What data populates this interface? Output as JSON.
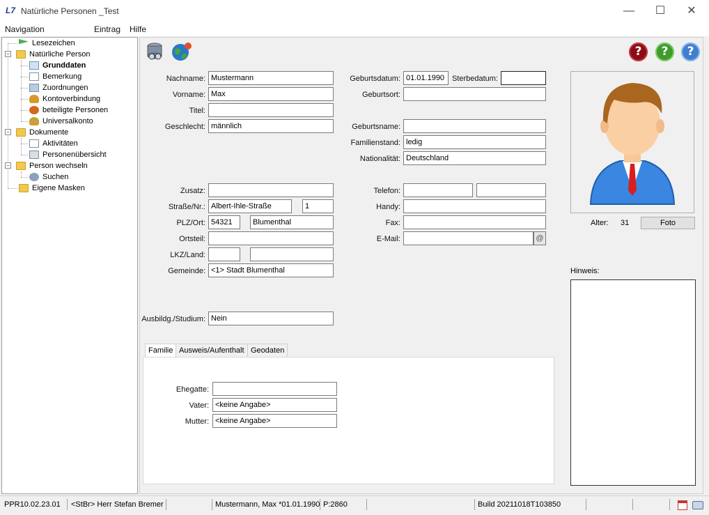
{
  "window": {
    "title": "Natürliche Personen _Test",
    "minimize": "—",
    "maximize": "☐",
    "close": "✕"
  },
  "menu": [
    "Navigation",
    "Eintrag",
    "Hilfe"
  ],
  "tree": {
    "items": [
      {
        "label": "Lesezeichen"
      },
      {
        "label": "Natürliche Person"
      },
      {
        "label": "Grunddaten"
      },
      {
        "label": "Bemerkung"
      },
      {
        "label": "Zuordnungen"
      },
      {
        "label": "Kontoverbindung"
      },
      {
        "label": "beteiligte Personen"
      },
      {
        "label": "Universalkonto"
      },
      {
        "label": "Dokumente"
      },
      {
        "label": "Aktivitäten"
      },
      {
        "label": "Personenübersicht"
      },
      {
        "label": "Person wechseln"
      },
      {
        "label": "Suchen"
      },
      {
        "label": "Eigene Masken"
      }
    ]
  },
  "form": {
    "nachname": {
      "label": "Nachname:",
      "value": "Mustermann"
    },
    "vorname": {
      "label": "Vorname:",
      "value": "Max"
    },
    "titel": {
      "label": "Titel:",
      "value": ""
    },
    "geschlecht": {
      "label": "Geschlecht:",
      "value": "männlich"
    },
    "geburtsdatum": {
      "label": "Geburtsdatum:",
      "value": "01.01.1990"
    },
    "sterbedatum": {
      "label": "Sterbedatum:",
      "value": ""
    },
    "geburtsort": {
      "label": "Geburtsort:",
      "value": ""
    },
    "geburtsname": {
      "label": "Geburtsname:",
      "value": ""
    },
    "familienstand": {
      "label": "Familienstand:",
      "value": "ledig"
    },
    "nationalitaet": {
      "label": "Nationalität:",
      "value": "Deutschland"
    },
    "zusatz": {
      "label": "Zusatz:",
      "value": ""
    },
    "strasse": {
      "label": "Straße/Nr.:",
      "value": "Albert-Ihle-Straße",
      "nr": "1"
    },
    "plzort": {
      "label": "PLZ/Ort:",
      "plz": "54321",
      "ort": "Blumenthal"
    },
    "ortsteil": {
      "label": "Ortsteil:",
      "value": ""
    },
    "lkzland": {
      "label": "LKZ/Land:",
      "lkz": "",
      "land": ""
    },
    "gemeinde": {
      "label": "Gemeinde:",
      "value": "<1> Stadt Blumenthal"
    },
    "telefon": {
      "label": "Telefon:",
      "value1": "",
      "value2": ""
    },
    "handy": {
      "label": "Handy:",
      "value": ""
    },
    "fax": {
      "label": "Fax:",
      "value": ""
    },
    "email": {
      "label": "E-Mail:",
      "value": "",
      "icon": "@"
    },
    "ausbildung": {
      "label": "Ausbildg./Studium:",
      "value": "Nein"
    }
  },
  "photo": {
    "alter_label": "Alter:",
    "alter_value": "31",
    "foto_button": "Foto",
    "hinweis_label": "Hinweis:"
  },
  "help_buttons": [
    "?",
    "?",
    "?"
  ],
  "tabs": [
    "Familie",
    "Ausweis/Aufenthalt",
    "Geodaten"
  ],
  "familie": {
    "ehegatte": {
      "label": "Ehegatte:",
      "value": ""
    },
    "vater": {
      "label": "Vater:",
      "value": "<keine Angabe>"
    },
    "mutter": {
      "label": "Mutter:",
      "value": "<keine Angabe>"
    }
  },
  "status": {
    "version": "PPR10.02.23.01",
    "user": "<StBr> Herr Stefan Bremer",
    "person": "Mustermann, Max *01.01.1990",
    "p": "P:2860",
    "build": "Build 20211018T103850"
  },
  "colors": {
    "help_red": "#8b0d16",
    "help_green": "#3e9c2d",
    "help_blue": "#3f7fcf"
  }
}
